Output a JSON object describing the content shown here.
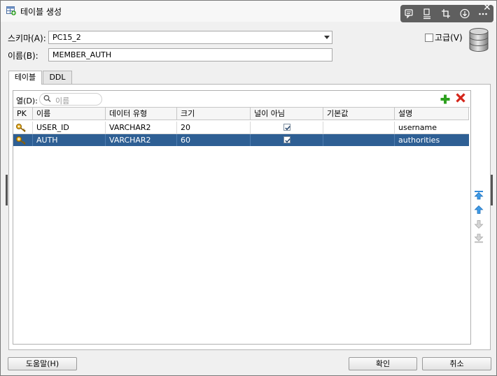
{
  "window": {
    "title": "테이블 생성"
  },
  "toolbar": {
    "icons": [
      "comment-icon",
      "outline-icon",
      "crop-icon",
      "download-icon",
      "more-icon",
      "close-icon"
    ]
  },
  "form": {
    "schema_label": "스키마(A):",
    "schema_value": "PC15_2",
    "name_label": "이름(B):",
    "name_value": "MEMBER_AUTH",
    "advanced_label": "고급(V)",
    "advanced_checked": false
  },
  "tabs": [
    {
      "label": "테이블",
      "active": true
    },
    {
      "label": "DDL",
      "active": false
    }
  ],
  "columns_panel": {
    "filter_label": "열(D):",
    "filter_placeholder": "이름",
    "headers": [
      "PK",
      "이름",
      "데이터 유형",
      "크기",
      "널이 아님",
      "기본값",
      "설명"
    ],
    "rows": [
      {
        "pk": true,
        "name": "USER_ID",
        "type": "VARCHAR2",
        "size": "20",
        "not_null": true,
        "default": "",
        "comment": "username",
        "selected": false
      },
      {
        "pk": true,
        "name": "AUTH",
        "type": "VARCHAR2",
        "size": "60",
        "not_null": true,
        "default": "",
        "comment": "authorities",
        "selected": true
      }
    ]
  },
  "buttons": {
    "help": "도움말(H)",
    "ok": "확인",
    "cancel": "취소"
  },
  "colors": {
    "selection": "#2e5f94",
    "add": "#2ea01f",
    "remove": "#d4251a",
    "move": "#1f7fd6"
  }
}
